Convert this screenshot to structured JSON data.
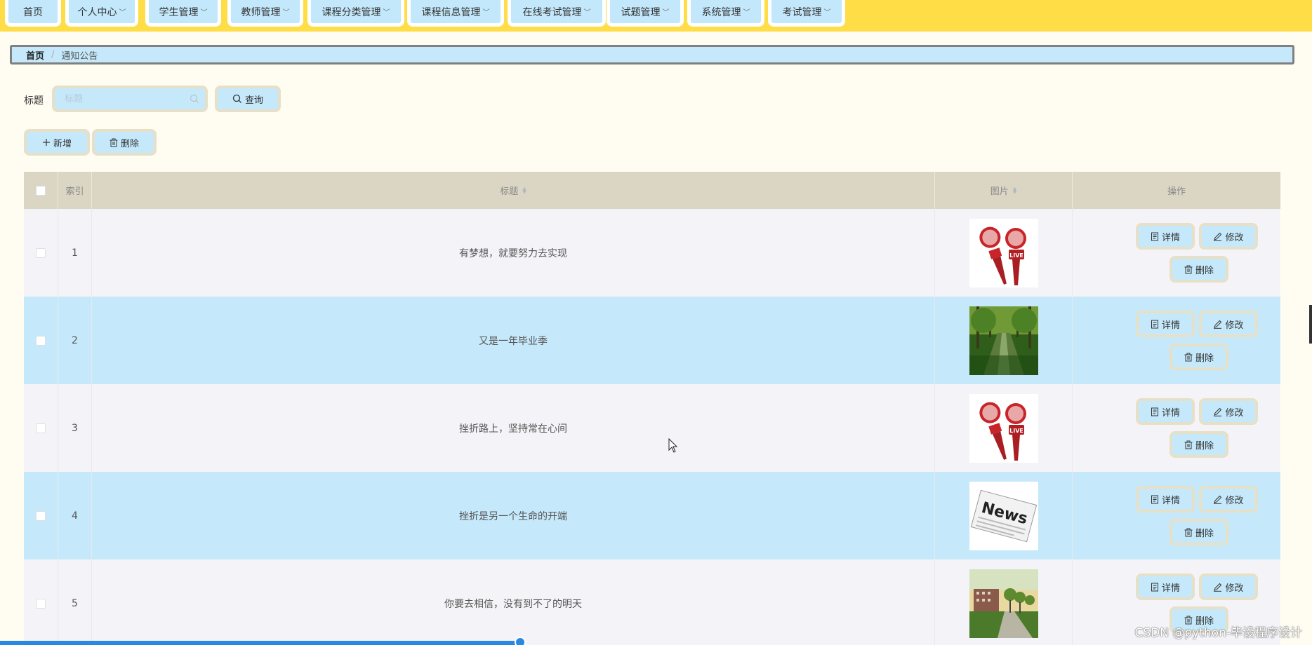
{
  "nav": {
    "items": [
      {
        "label": "首页",
        "has_dropdown": false
      },
      {
        "label": "个人中心",
        "has_dropdown": true
      },
      {
        "label": "学生管理",
        "has_dropdown": true
      },
      {
        "label": "教师管理",
        "has_dropdown": true
      },
      {
        "label": "课程分类管理",
        "has_dropdown": true
      },
      {
        "label": "课程信息管理",
        "has_dropdown": true
      },
      {
        "label": "在线考试管理",
        "has_dropdown": true
      },
      {
        "label": "试题管理",
        "has_dropdown": true
      },
      {
        "label": "系统管理",
        "has_dropdown": true
      },
      {
        "label": "考试管理",
        "has_dropdown": true
      }
    ]
  },
  "breadcrumb": {
    "home": "首页",
    "separator": "/",
    "current": "通知公告"
  },
  "search": {
    "label": "标题",
    "placeholder": "标题",
    "value": "",
    "button_label": "查询"
  },
  "toolbar": {
    "add_label": "新增",
    "delete_label": "删除"
  },
  "table": {
    "headers": {
      "index": "索引",
      "title": "标题",
      "image": "图片",
      "actions": "操作"
    },
    "rows": [
      {
        "index": "1",
        "title": "有梦想，就要努力去实现",
        "image": "microphone-live"
      },
      {
        "index": "2",
        "title": "又是一年毕业季",
        "image": "tree-lined-road"
      },
      {
        "index": "3",
        "title": "挫折路上，坚持常在心间",
        "image": "microphone-live"
      },
      {
        "index": "4",
        "title": "挫折是另一个生命的开端",
        "image": "news-newspaper"
      },
      {
        "index": "5",
        "title": "你要去相信，没有到不了的明天",
        "image": "campus-building"
      }
    ],
    "row_actions": {
      "detail": "详情",
      "edit": "修改",
      "delete": "删除"
    }
  },
  "watermark": "CSDN @python-毕设程序设计",
  "colors": {
    "nav_bg": "#fedd47",
    "button_bg": "#c5e9fb",
    "button_border": "#e7e0c8",
    "header_bg": "#dad6c3",
    "row_alt_bg": "#c5e9fb",
    "page_bg": "#fffdf2"
  }
}
